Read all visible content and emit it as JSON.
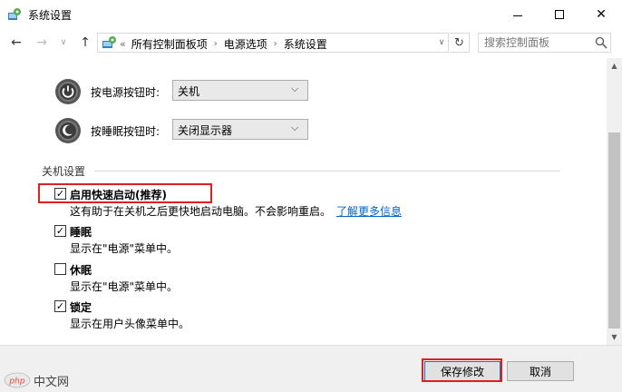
{
  "window": {
    "title": "系统设置",
    "minimize_glyph": "",
    "maximize_glyph": "",
    "close_glyph": "✕"
  },
  "nav": {
    "back_glyph": "←",
    "forward_glyph": "→",
    "recent_glyph": "∨",
    "up_glyph": "↑",
    "breadcrumb_lead": "«",
    "breadcrumbs": [
      "所有控制面板项",
      "电源选项",
      "系统设置"
    ],
    "crumb_separator": "›",
    "dropdown_glyph": "∨",
    "refresh_glyph": "↻",
    "search_placeholder": "搜索控制面板"
  },
  "power_buttons": [
    {
      "label": "按电源按钮时:",
      "value": "关机",
      "icon": "power-icon"
    },
    {
      "label": "按睡眠按钮时:",
      "value": "关闭显示器",
      "icon": "sleep-icon"
    }
  ],
  "chevron_glyph": "⌵",
  "shutdown_settings": {
    "group_label": "关机设置",
    "options": [
      {
        "title": "启用快速启动(推荐)",
        "checked": true,
        "description": "这有助于在关机之后更快地启动电脑。不会影响重启。",
        "link": "了解更多信息"
      },
      {
        "title": "睡眠",
        "checked": true,
        "description": "显示在\"电源\"菜单中。"
      },
      {
        "title": "休眠",
        "checked": false,
        "description": "显示在\"电源\"菜单中。"
      },
      {
        "title": "锁定",
        "checked": true,
        "description": "显示在用户头像菜单中。"
      }
    ]
  },
  "check_glyph": "✓",
  "footer": {
    "save_label": "保存修改",
    "cancel_label": "取消"
  },
  "watermark": {
    "text": "中文网"
  },
  "colors": {
    "highlight": "#e02020",
    "link": "#0066cc",
    "accent": "#0078d7"
  }
}
